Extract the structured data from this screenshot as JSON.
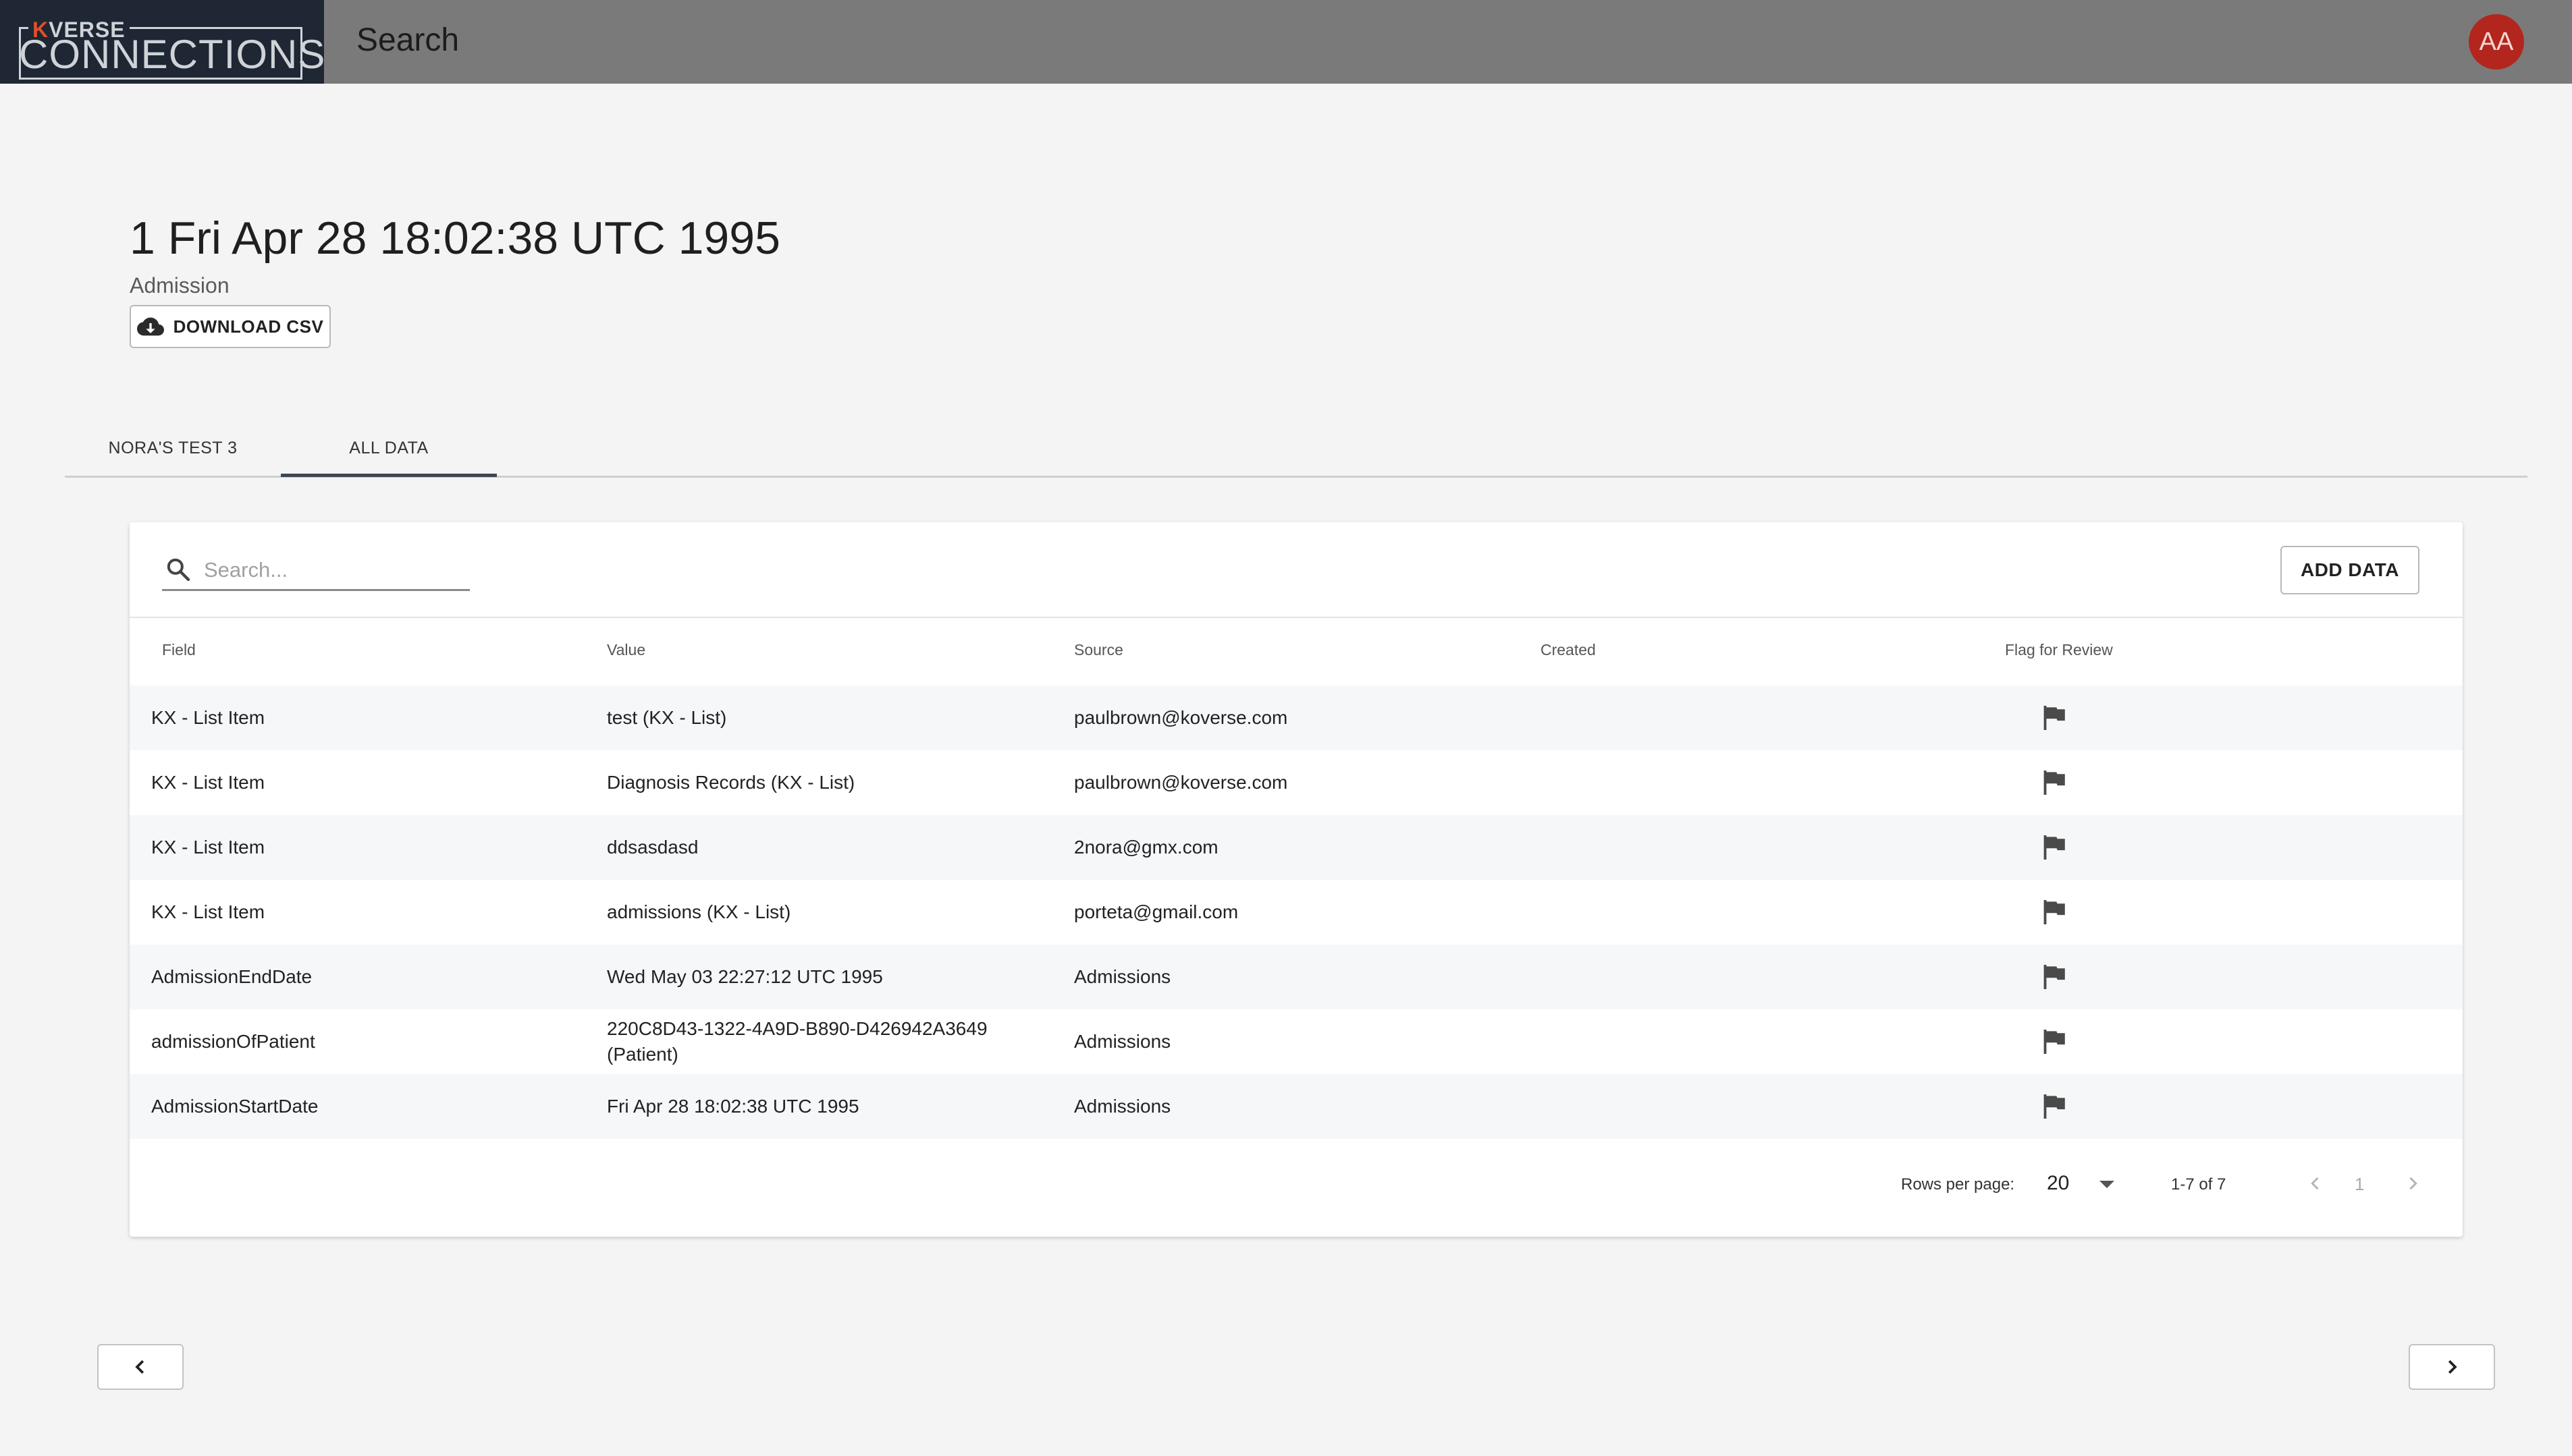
{
  "app": {
    "logo_top_accent": "K",
    "logo_top_rest": "VERSE",
    "logo_bottom": "CONNECTIONS",
    "page_title": "Search",
    "user_initials": "AA",
    "colors": {
      "topbar": "#7a7a7a",
      "logo_bg": "#1e2733",
      "avatar": "#b3261e",
      "logo_accent": "#e0502a"
    }
  },
  "record": {
    "title": "1 Fri Apr 28 18:02:38 UTC 1995",
    "subtitle": "Admission",
    "download_label": "DOWNLOAD CSV",
    "download_icon": "cloud-download-icon"
  },
  "tabs": [
    {
      "label": "NORA'S TEST 3",
      "active": false
    },
    {
      "label": "ALL DATA",
      "active": true
    }
  ],
  "table": {
    "search_placeholder": "Search...",
    "search_value": "",
    "add_label": "ADD DATA",
    "headers": [
      "Field",
      "Value",
      "Source",
      "Created",
      "Flag for Review"
    ],
    "rows": [
      {
        "field": "KX - List Item",
        "value": "test (KX - List)",
        "source": "paulbrown@koverse.com",
        "created": "",
        "flag_icon": "flag-icon"
      },
      {
        "field": "KX - List Item",
        "value": "Diagnosis Records (KX - List)",
        "source": "paulbrown@koverse.com",
        "created": "",
        "flag_icon": "flag-icon"
      },
      {
        "field": "KX - List Item",
        "value": "ddsasdasd",
        "source": "2nora@gmx.com",
        "created": "",
        "flag_icon": "flag-icon"
      },
      {
        "field": "KX - List Item",
        "value": "admissions (KX - List)",
        "source": "porteta@gmail.com",
        "created": "",
        "flag_icon": "flag-icon"
      },
      {
        "field": "AdmissionEndDate",
        "value": "Wed May 03 22:27:12 UTC 1995",
        "source": "Admissions",
        "created": "",
        "flag_icon": "flag-icon"
      },
      {
        "field": "admissionOfPatient",
        "value": "220C8D43-1322-4A9D-B890-D426942A3649 (Patient)",
        "source": "Admissions",
        "created": "",
        "flag_icon": "flag-icon"
      },
      {
        "field": "AdmissionStartDate",
        "value": "Fri Apr 28 18:02:38 UTC 1995",
        "source": "Admissions",
        "created": "",
        "flag_icon": "flag-icon"
      }
    ]
  },
  "pagination": {
    "rows_per_page_label": "Rows per page:",
    "rows_per_page_value": "20",
    "range": "1-7 of 7",
    "current_page": "1"
  },
  "navigation": {
    "prev_icon": "chevron-left-icon",
    "next_icon": "chevron-right-icon"
  }
}
